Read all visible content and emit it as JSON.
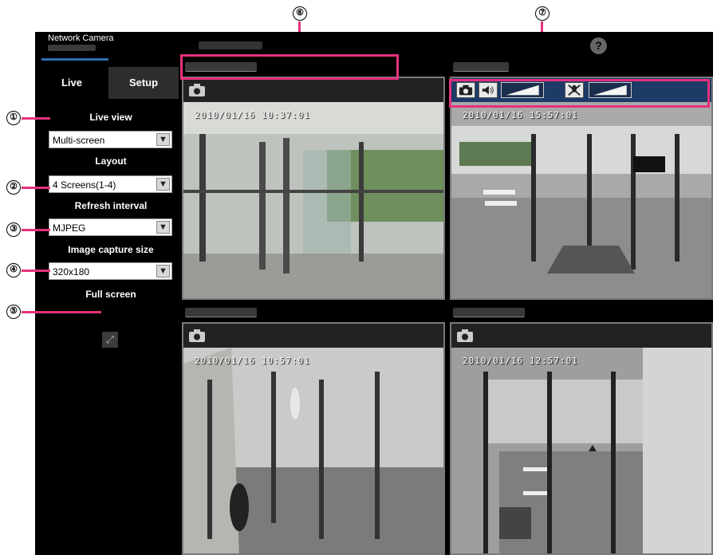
{
  "header": {
    "brand": "Network Camera",
    "help_icon": "?"
  },
  "tabs": [
    {
      "label": "Live",
      "active": true
    },
    {
      "label": "Setup",
      "active": false
    }
  ],
  "sidebar": {
    "live_view": {
      "label": "Live view",
      "value": "Multi-screen"
    },
    "layout": {
      "label": "Layout",
      "value": "4 Screens(1-4)"
    },
    "refresh": {
      "label": "Refresh interval",
      "value": "MJPEG"
    },
    "capture": {
      "label": "Image capture size",
      "value": "320x180"
    },
    "full_screen": {
      "label": "Full screen"
    },
    "dropdown_arrow": "▼",
    "fs_glyph": "⤢"
  },
  "panes": [
    {
      "timestamp": "2010/01/16 10:37:01"
    },
    {
      "timestamp": "2010/01/16 15:57:01"
    },
    {
      "timestamp": "2010/01/16 10:57:01"
    },
    {
      "timestamp": "2010/01/16 12:57:01"
    }
  ],
  "controls": {
    "mute_glyph": "✕"
  },
  "callouts": [
    "①",
    "②",
    "③",
    "④",
    "⑤",
    "⑥",
    "⑦"
  ],
  "colors": {
    "annotation": "#e5317d",
    "control_bar": "#1d3b66"
  }
}
